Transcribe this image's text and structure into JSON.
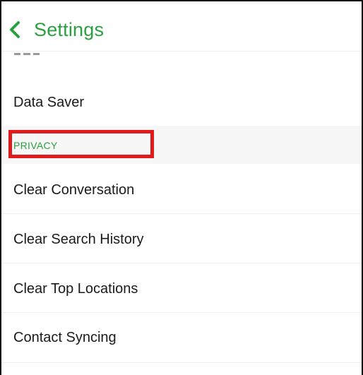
{
  "header": {
    "back_icon": "chevron-left-icon",
    "title": "Settings",
    "accent_color": "#2aa040"
  },
  "list": {
    "data_saver_label": "Data Saver",
    "privacy_section_title": "PRIVACY",
    "clear_conversation_label": "Clear Conversation",
    "clear_search_history_label": "Clear Search History",
    "clear_top_locations_label": "Clear Top Locations",
    "contact_syncing_label": "Contact Syncing"
  },
  "annotation": {
    "highlight_color": "#e11b1b"
  }
}
